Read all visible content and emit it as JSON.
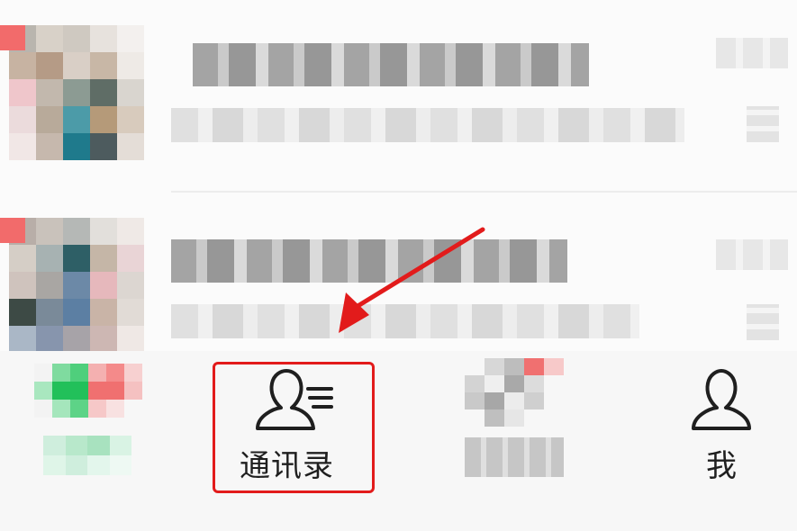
{
  "tabbar": {
    "tabs": [
      {
        "id": "chats",
        "label": ""
      },
      {
        "id": "contacts",
        "label": "通讯录",
        "icon": "contacts-icon"
      },
      {
        "id": "discover",
        "label": ""
      },
      {
        "id": "me",
        "label": "我",
        "icon": "person-icon"
      }
    ]
  },
  "colors": {
    "highlight": "#e21b1b",
    "badge": "#f26b6b",
    "chats_green": "#22c05a"
  }
}
